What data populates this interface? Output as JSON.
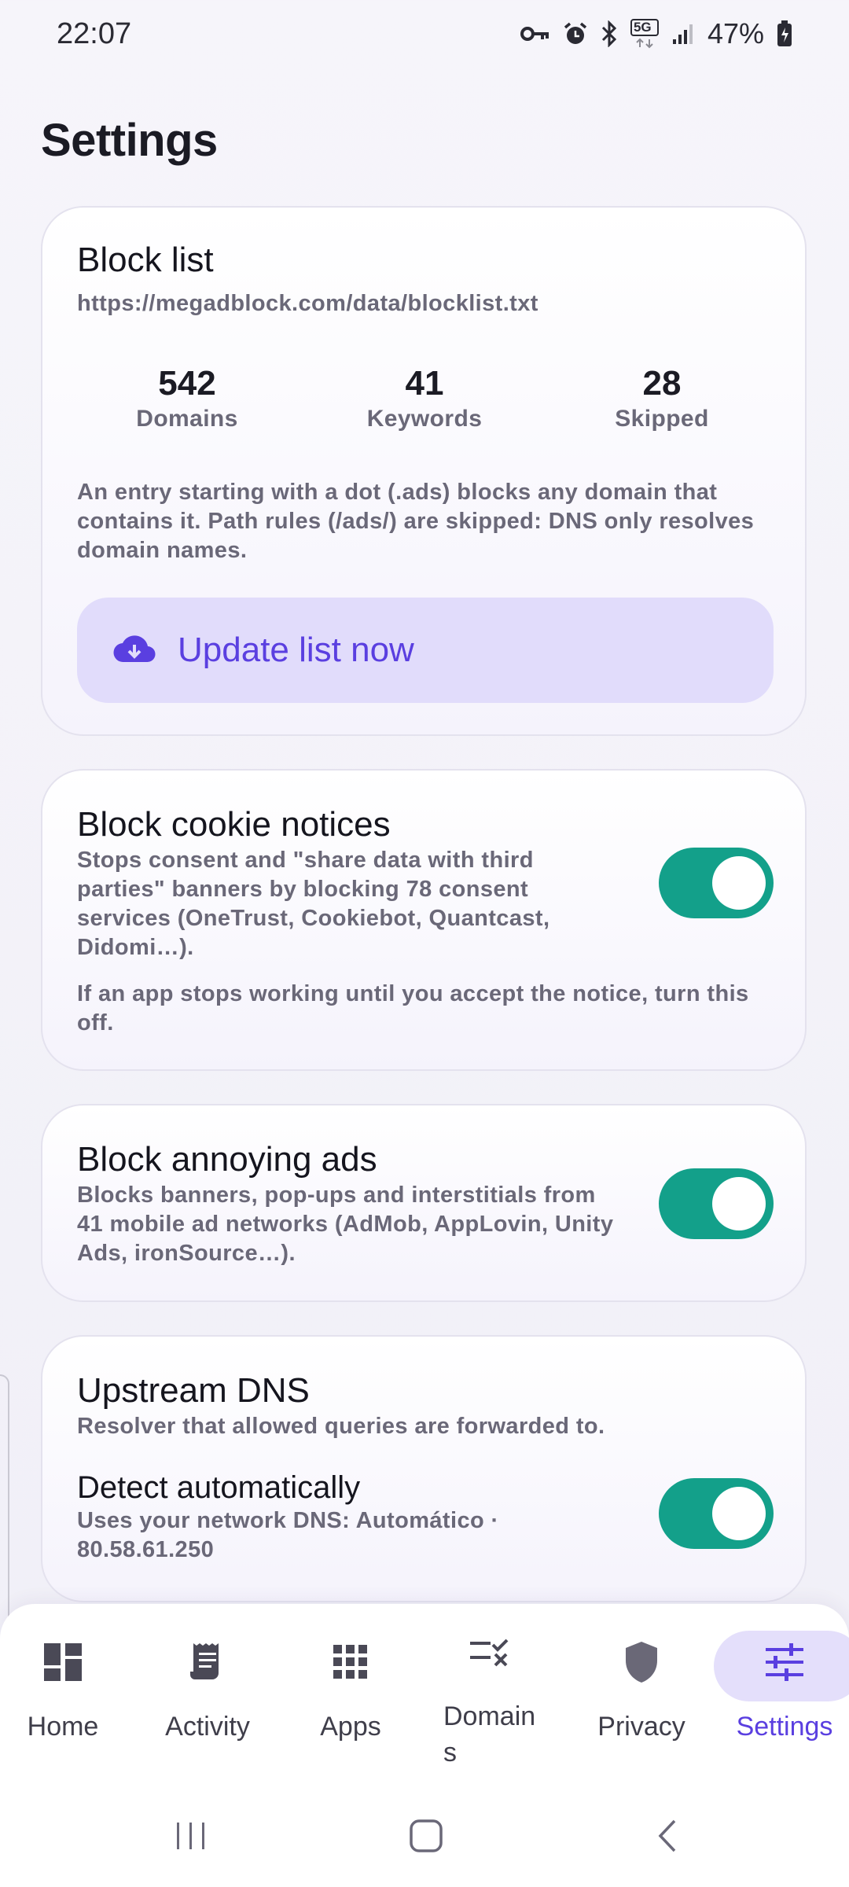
{
  "status": {
    "time": "22:07",
    "battery": "47%",
    "network": "5G",
    "icons": [
      "key-icon",
      "alarm-icon",
      "bluetooth-icon",
      "5g-icon",
      "signal-icon",
      "battery-icon"
    ]
  },
  "page": {
    "title": "Settings"
  },
  "blocklist": {
    "title": "Block list",
    "url": "https://megadblock.com/data/blocklist.txt",
    "stats": [
      {
        "value": "542",
        "label": "Domains"
      },
      {
        "value": "41",
        "label": "Keywords"
      },
      {
        "value": "28",
        "label": "Skipped"
      }
    ],
    "note": "An entry starting with a dot (.ads) blocks any domain that contains it. Path rules (/ads/) are skipped: DNS only resolves domain names.",
    "update_label": "Update list now"
  },
  "cookies": {
    "title": "Block cookie notices",
    "desc": "Stops consent and \"share data with third parties\" banners by blocking 78 consent services (OneTrust, Cookiebot, Quantcast, Didomi…).",
    "note": "If an app stops working until you accept the notice, turn this off.",
    "enabled": true
  },
  "ads": {
    "title": "Block annoying ads",
    "desc": "Blocks banners, pop-ups and interstitials from 41 mobile ad networks (AdMob, AppLovin, Unity Ads, ironSource…).",
    "enabled": true
  },
  "dns": {
    "title": "Upstream DNS",
    "subtitle": "Resolver that allowed queries are forwarded to.",
    "auto_title": "Detect automatically",
    "auto_desc": "Uses your network DNS: Automático · 80.58.61.250",
    "enabled": true
  },
  "nav": {
    "items": [
      {
        "label": "Home",
        "icon": "dashboard-icon"
      },
      {
        "label": "Activity",
        "icon": "receipt-icon"
      },
      {
        "label": "Apps",
        "icon": "apps-grid-icon"
      },
      {
        "label": "Domain\ns",
        "icon": "rule-icon"
      },
      {
        "label": "Privacy",
        "icon": "shield-icon"
      },
      {
        "label": "Settings",
        "icon": "tune-icon"
      }
    ],
    "active": "Settings",
    "accent": "#5a3fe0"
  },
  "colors": {
    "toggle_on": "#13a08a",
    "accent_bg": "#e1dcfb",
    "accent": "#5a3fe0"
  }
}
